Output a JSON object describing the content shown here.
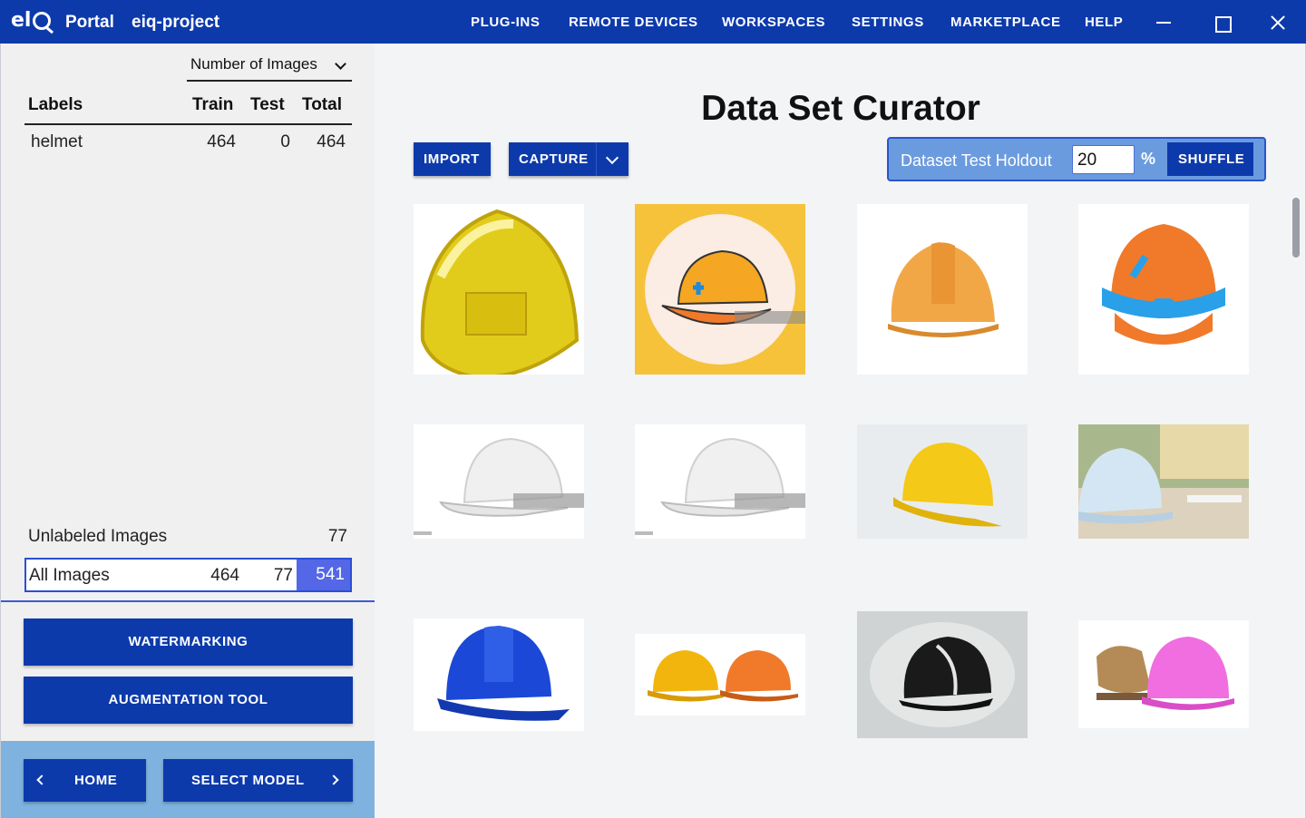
{
  "titlebar": {
    "app_name": "Portal",
    "project_name": "eiq-project",
    "nav": [
      "PLUG-INS",
      "REMOTE DEVICES",
      "WORKSPACES",
      "SETTINGS",
      "MARKETPLACE",
      "HELP"
    ],
    "accent_color": "#0d3aab"
  },
  "sidebar": {
    "sort_dropdown": "Number of Images",
    "table_headers": {
      "labels": "Labels",
      "train": "Train",
      "test": "Test",
      "total": "Total"
    },
    "labels": [
      {
        "name": "helmet",
        "train": "464",
        "test": "0",
        "total": "464"
      }
    ],
    "unlabeled": {
      "label": "Unlabeled Images",
      "count": "77"
    },
    "all_images": {
      "label": "All Images",
      "train": "464",
      "test": "77",
      "total": "541"
    },
    "buttons": {
      "watermarking": "WATERMARKING",
      "augmentation": "AUGMENTATION TOOL"
    },
    "footer": {
      "home": "HOME",
      "select_model": "SELECT MODEL"
    }
  },
  "main": {
    "title": "Data Set Curator",
    "import_label": "IMPORT",
    "capture_label": "CAPTURE",
    "holdout": {
      "label": "Dataset Test Holdout",
      "value": "20",
      "unit": "%",
      "shuffle_label": "SHUFFLE"
    },
    "images": [
      {
        "name": "yellow-glossy-helmet",
        "color": "#e6cf12"
      },
      {
        "name": "cartoon-orange-helmet-on-yellow",
        "color": "#f5c23a"
      },
      {
        "name": "orange-3d-helmet",
        "color": "#f3a23f"
      },
      {
        "name": "orange-blue-3d-helmet",
        "color": "#ef7a2a"
      },
      {
        "name": "white-helmet-1",
        "color": "#f1f1f1"
      },
      {
        "name": "white-helmet-2",
        "color": "#f1f1f1"
      },
      {
        "name": "yellow-helmet-photo",
        "color": "#f4c918"
      },
      {
        "name": "light-blue-helmet-on-desk",
        "color": "#c9dff0"
      },
      {
        "name": "blue-helmet",
        "color": "#1b48d6"
      },
      {
        "name": "yellow-and-orange-helmets",
        "color": "#f2b50d"
      },
      {
        "name": "black-helmet-sketch",
        "color": "#1a1a1a"
      },
      {
        "name": "pink-helmet-with-gloves",
        "color": "#f06ee0"
      }
    ]
  }
}
